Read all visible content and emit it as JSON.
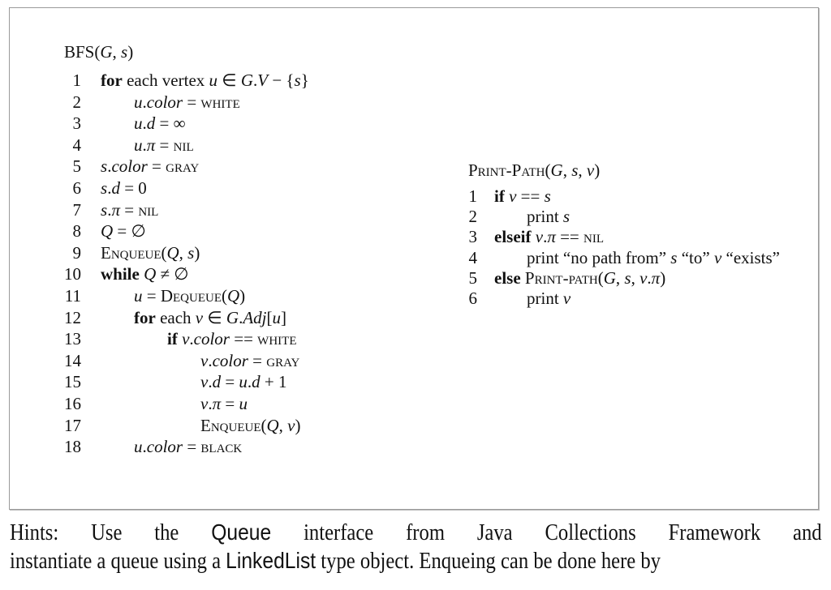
{
  "bfs": {
    "title": "BFS(G, s)",
    "lines": [
      {
        "num": "1",
        "indent": 0,
        "text": "for each vertex u ∈ G.V − {s}"
      },
      {
        "num": "2",
        "indent": 1,
        "text": "u.color = WHITE"
      },
      {
        "num": "3",
        "indent": 1,
        "text": "u.d = ∞"
      },
      {
        "num": "4",
        "indent": 1,
        "text": "u.π = NIL"
      },
      {
        "num": "5",
        "indent": 0,
        "text": "s.color = GRAY"
      },
      {
        "num": "6",
        "indent": 0,
        "text": "s.d = 0"
      },
      {
        "num": "7",
        "indent": 0,
        "text": "s.π = NIL"
      },
      {
        "num": "8",
        "indent": 0,
        "text": "Q = ∅"
      },
      {
        "num": "9",
        "indent": 0,
        "text": "ENQUEUE(Q, s)"
      },
      {
        "num": "10",
        "indent": 0,
        "text": "while Q ≠ ∅"
      },
      {
        "num": "11",
        "indent": 1,
        "text": "u = DEQUEUE(Q)"
      },
      {
        "num": "12",
        "indent": 1,
        "text": "for each v ∈ G.Adj[u]"
      },
      {
        "num": "13",
        "indent": 2,
        "text": "if v.color == WHITE"
      },
      {
        "num": "14",
        "indent": 3,
        "text": "v.color = GRAY"
      },
      {
        "num": "15",
        "indent": 3,
        "text": "v.d = u.d + 1"
      },
      {
        "num": "16",
        "indent": 3,
        "text": "v.π = u"
      },
      {
        "num": "17",
        "indent": 3,
        "text": "ENQUEUE(Q, v)"
      },
      {
        "num": "18",
        "indent": 1,
        "text": "u.color = BLACK"
      }
    ]
  },
  "print_path": {
    "title": "PRINT-PATH(G, s, v)",
    "lines": [
      {
        "num": "1",
        "indent": 0,
        "text": "if v == s"
      },
      {
        "num": "2",
        "indent": 1,
        "text": "print s"
      },
      {
        "num": "3",
        "indent": 0,
        "text": "elseif v.π == NIL"
      },
      {
        "num": "4",
        "indent": 1,
        "text": "print “no path from” s “to” v “exists”"
      },
      {
        "num": "5",
        "indent": 0,
        "text": "else PRINT-PATH(G, s, v.π)"
      },
      {
        "num": "6",
        "indent": 1,
        "text": "print v"
      }
    ]
  },
  "hints": {
    "line1": [
      "Hints:",
      "Use",
      "the",
      "Queue",
      "interface",
      "from",
      "Java",
      "Collections",
      "Framework",
      "and"
    ],
    "line2_before": "instantiate a queue using a ",
    "line2_code": "LinkedList",
    "line2_after": " type object. Enqueing can be done here by"
  }
}
